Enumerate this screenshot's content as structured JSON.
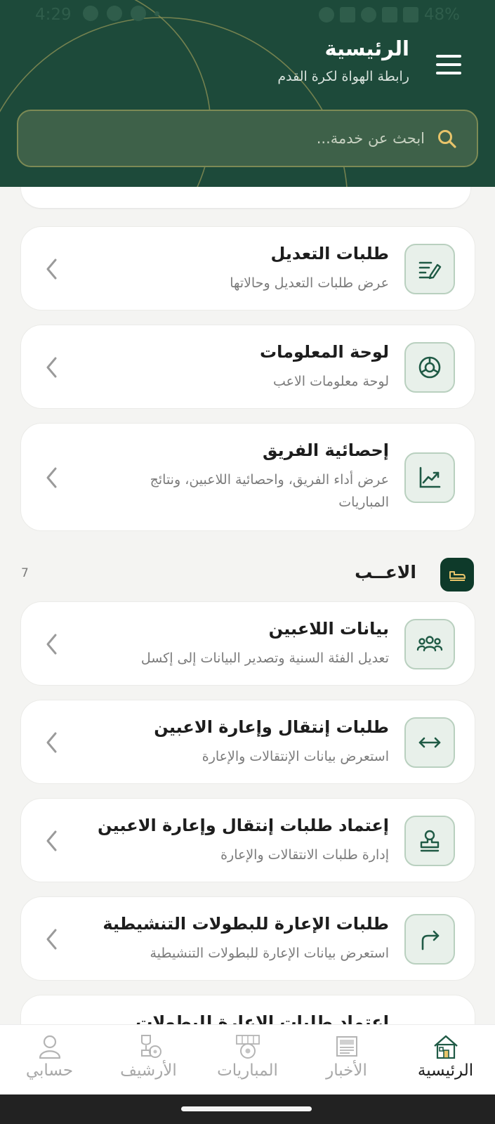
{
  "status_bar": {
    "time": "4:29",
    "battery": "48%"
  },
  "header": {
    "title": "الرئيسية",
    "subtitle": "رابطة الهواة لكرة القدم",
    "colors": {
      "background": "#1d4a3a",
      "accent": "#1f5a45"
    }
  },
  "search": {
    "placeholder": "ابحث عن خدمة..."
  },
  "cards_top": [
    {
      "title": "طلبات التعديل",
      "desc": "عرض طلبات التعديل وحالاتها",
      "icon": "edit-list-icon"
    },
    {
      "title": "لوحة المعلومات",
      "desc": "لوحة معلومات الاعب",
      "icon": "dashboard-icon"
    },
    {
      "title": "إحصائية الفريق",
      "desc": "عرض أداء الفريق، واحصائية اللاعبين، ونتائج المباريات",
      "icon": "chart-icon"
    }
  ],
  "section": {
    "title": "الاعــب",
    "count": "7",
    "icon": "player-icon"
  },
  "cards_players": [
    {
      "title": "بيانات اللاعبين",
      "desc": "تعديل الفئة السنية وتصدير البيانات إلى إكسل",
      "icon": "group-icon"
    },
    {
      "title": "طلبات إنتقال وإعارة الاعبين",
      "desc": "استعرض بيانات الإنتقالات والإعارة",
      "icon": "transfer-icon"
    },
    {
      "title": "إعتماد طلبات إنتقال وإعارة الاعبين",
      "desc": "إدارة طلبات الانتقالات والإعارة",
      "icon": "stamp-icon"
    },
    {
      "title": "طلبات الإعارة للبطولات التنشيطية",
      "desc": "استعرض بيانات الإعارة للبطولات التنشيطية",
      "icon": "forward-icon"
    },
    {
      "title": "إعتماد طلبات الإعارة للبطولات",
      "desc": "",
      "icon": "stamp-icon"
    }
  ],
  "bottom_nav": [
    {
      "label": "الرئيسية",
      "icon": "home-icon",
      "active": true
    },
    {
      "label": "الأخبار",
      "icon": "news-icon",
      "active": false
    },
    {
      "label": "المباريات",
      "icon": "matches-icon",
      "active": false
    },
    {
      "label": "الأرشيف",
      "icon": "archive-icon",
      "active": false
    },
    {
      "label": "حسابي",
      "icon": "profile-icon",
      "active": false
    }
  ]
}
